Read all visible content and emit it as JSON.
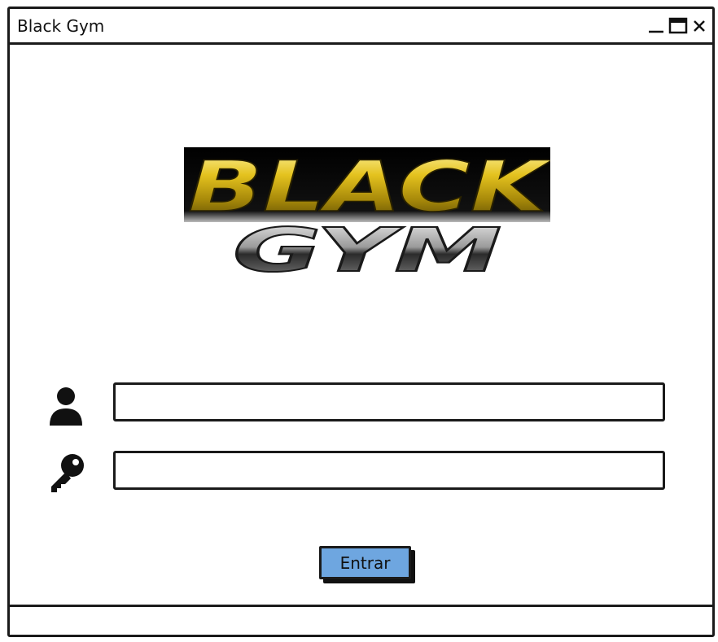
{
  "window": {
    "title": "Black Gym"
  },
  "window_controls": {
    "minimize_icon": "minimize-icon",
    "maximize_icon": "maximize-icon",
    "close_icon": "close-icon"
  },
  "logo": {
    "line1": "BLACK",
    "line2": "GYM",
    "colors": {
      "gold": "#d9b514",
      "gold_dark": "#6b5a05",
      "silver": "#c9c9c9",
      "steel_dark": "#2a2a2a",
      "band": "#000000"
    }
  },
  "login_form": {
    "username": {
      "icon": "user-icon",
      "value": "",
      "placeholder": ""
    },
    "password": {
      "icon": "key-icon",
      "value": "",
      "placeholder": ""
    },
    "submit_label": "Entrar",
    "submit_color": "#6ea6e0"
  },
  "statusbar": {
    "text": ""
  }
}
